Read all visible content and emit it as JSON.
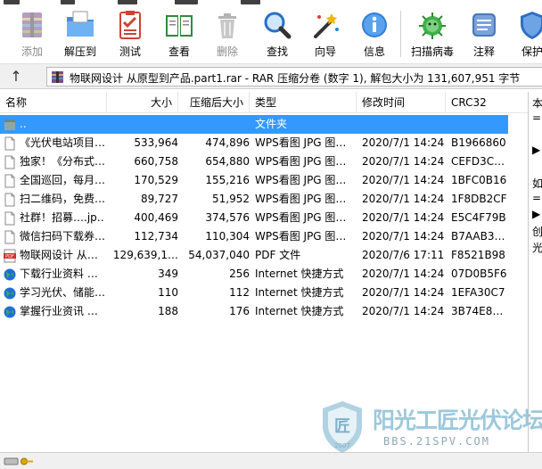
{
  "toolbar": {
    "buttons": [
      {
        "label": "添加",
        "icon": "archive-add-icon",
        "disabled": true
      },
      {
        "label": "解压到",
        "icon": "extract-folder-icon",
        "disabled": false
      },
      {
        "label": "测试",
        "icon": "test-checklist-icon",
        "disabled": false
      },
      {
        "label": "查看",
        "icon": "view-book-icon",
        "disabled": false
      },
      {
        "label": "删除",
        "icon": "trash-icon",
        "disabled": true
      },
      {
        "label": "查找",
        "icon": "find-magnifier-icon",
        "disabled": false
      },
      {
        "label": "向导",
        "icon": "wizard-wand-icon",
        "disabled": false
      },
      {
        "label": "信息",
        "icon": "info-icon",
        "disabled": false
      },
      {
        "label": "扫描病毒",
        "icon": "virus-scan-icon",
        "disabled": false
      },
      {
        "label": "注释",
        "icon": "comment-icon",
        "disabled": false
      },
      {
        "label": "保护",
        "icon": "protect-shield-icon",
        "disabled": false
      }
    ]
  },
  "address": {
    "up_glyph": "↑",
    "path": "物联网设计 从原型到产品.part1.rar - RAR 压缩分卷 (数字 1), 解包大小为 131,607,951 字节"
  },
  "columns": {
    "name": "名称",
    "size": "大小",
    "packed": "压缩后大小",
    "type": "类型",
    "modified": "修改时间",
    "crc": "CRC32"
  },
  "files": [
    {
      "name": "..",
      "size": "",
      "packed": "",
      "type": "文件夹",
      "modified": "",
      "crc": "",
      "icon": "folder-up-icon",
      "selected": true
    },
    {
      "name": "《光伏电站项目…",
      "size": "533,964",
      "packed": "474,896",
      "type": "WPS看图 JPG 图…",
      "modified": "2020/7/1 14:24",
      "crc": "B1966860",
      "icon": "file-icon",
      "selected": false
    },
    {
      "name": "独家！《分布式…",
      "size": "660,758",
      "packed": "654,880",
      "type": "WPS看图 JPG 图…",
      "modified": "2020/7/1 14:24",
      "crc": "CEFD3C…",
      "icon": "file-icon",
      "selected": false
    },
    {
      "name": "全国巡回，每月…",
      "size": "170,529",
      "packed": "155,216",
      "type": "WPS看图 JPG 图…",
      "modified": "2020/7/1 14:24",
      "crc": "1BFC0B16",
      "icon": "file-icon",
      "selected": false
    },
    {
      "name": "扫二维码，免费…",
      "size": "89,727",
      "packed": "51,952",
      "type": "WPS看图 JPG 图…",
      "modified": "2020/7/1 14:24",
      "crc": "1F8DB2CF",
      "icon": "file-icon",
      "selected": false
    },
    {
      "name": "社群！招募….jp…",
      "size": "400,469",
      "packed": "374,576",
      "type": "WPS看图 JPG 图…",
      "modified": "2020/7/1 14:24",
      "crc": "E5C4F79B",
      "icon": "file-icon",
      "selected": false
    },
    {
      "name": "微信扫码下载券…",
      "size": "112,734",
      "packed": "110,304",
      "type": "WPS看图 JPG 图…",
      "modified": "2020/7/1 14:24",
      "crc": "B7AAB3…",
      "icon": "file-icon",
      "selected": false
    },
    {
      "name": "物联网设计 从…",
      "size": "129,639,1…",
      "packed": "54,037,040",
      "type": "PDF 文件",
      "modified": "2020/7/6 17:11",
      "crc": "F8521B98",
      "icon": "pdf-icon",
      "selected": false
    },
    {
      "name": "下载行业资料 …",
      "size": "349",
      "packed": "256",
      "type": "Internet 快捷方式",
      "modified": "2020/7/1 14:24",
      "crc": "07D0B5F6",
      "icon": "globe-icon",
      "selected": false
    },
    {
      "name": "学习光伏、储能…",
      "size": "110",
      "packed": "112",
      "type": "Internet 快捷方式",
      "modified": "2020/7/1 14:24",
      "crc": "1EFA30C7",
      "icon": "globe-icon",
      "selected": false
    },
    {
      "name": "掌握行业资讯 …",
      "size": "188",
      "packed": "176",
      "type": "Internet 快捷方式",
      "modified": "2020/7/1 14:24",
      "crc": "3B74E8…",
      "icon": "globe-icon",
      "selected": false
    }
  ],
  "side_pane": {
    "lines": [
      "本",
      "=",
      "",
      "▶",
      "",
      "如",
      "=",
      "▶",
      "创",
      "光"
    ]
  },
  "watermark": {
    "title": "阳光工匠光伏论坛",
    "url": "BBS.21SPV.COM",
    "badge_year": "2007",
    "badge_char": "匠"
  },
  "colors": {
    "selection": "#3399ff",
    "watermark": "#8bbfd6"
  }
}
